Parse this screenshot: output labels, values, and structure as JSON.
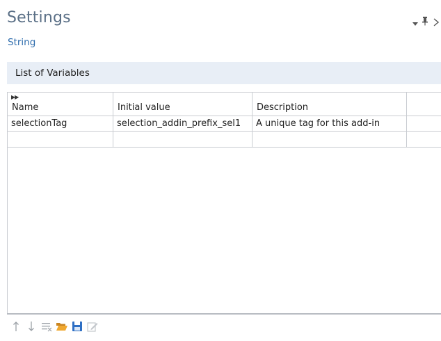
{
  "header": {
    "title": "Settings",
    "subtitle": "String",
    "controls": {
      "dropdown_icon": "dropdown-arrow-icon",
      "pin_icon": "pin-icon",
      "close_icon": "close-icon"
    }
  },
  "section": {
    "label": "List of Variables"
  },
  "table": {
    "columns": [
      "Name",
      "Initial value",
      "Description",
      ""
    ],
    "rows": [
      [
        "selectionTag",
        "selection_addin_prefix_sel1",
        "A unique tag for this add-in",
        ""
      ],
      [
        "",
        "",
        "",
        ""
      ]
    ]
  },
  "toolbar": {
    "buttons": [
      {
        "name": "move-up",
        "icon": "arrow-up-icon"
      },
      {
        "name": "move-down",
        "icon": "arrow-down-icon"
      },
      {
        "name": "clear-table",
        "icon": "clear-list-icon"
      },
      {
        "name": "load-from-file",
        "icon": "folder-open-icon"
      },
      {
        "name": "save-to-file",
        "icon": "save-icon"
      },
      {
        "name": "edit",
        "icon": "edit-icon"
      }
    ]
  },
  "colors": {
    "title": "#5a6f86",
    "subtitle": "#2f6dad",
    "section_bg": "#e8eef6",
    "grid_line": "#c9ccd1",
    "folder": "#e8a02e",
    "save": "#2e6fc4"
  }
}
